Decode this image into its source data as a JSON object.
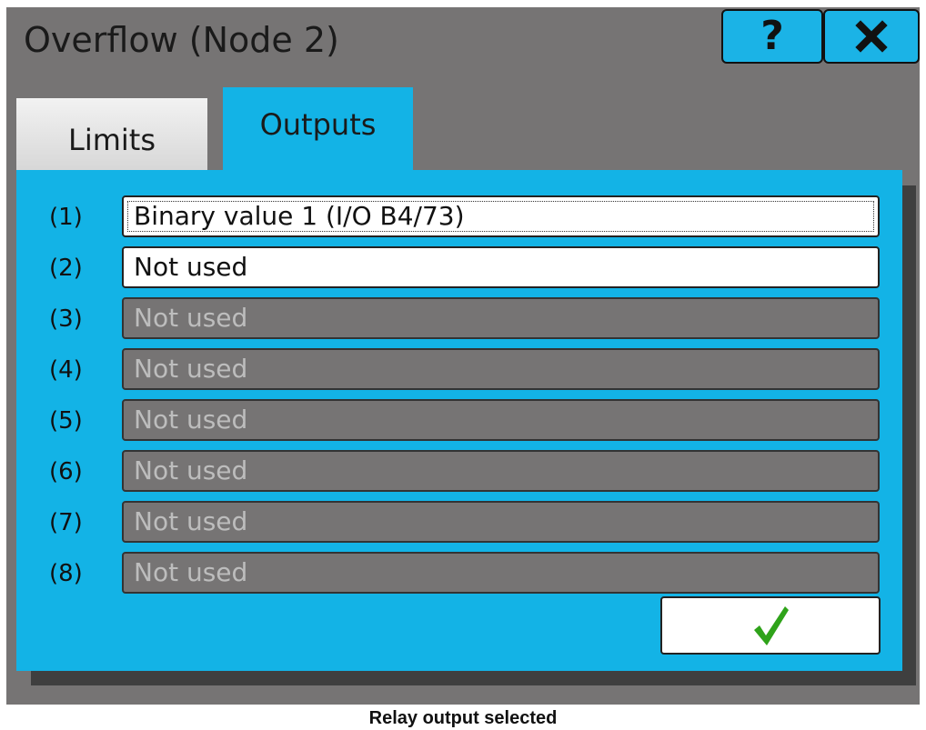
{
  "window": {
    "title": "Overflow (Node 2)",
    "help_label": "?",
    "accent_color": "#13b3e6",
    "background_color": "#767474"
  },
  "tabs": [
    {
      "label": "Limits",
      "active": false
    },
    {
      "label": "Outputs",
      "active": true
    }
  ],
  "outputs": [
    {
      "number": "(1)",
      "value": "Binary value 1 (I/O B4/73)",
      "state": "active",
      "focused": true
    },
    {
      "number": "(2)",
      "value": "Not used",
      "state": "active",
      "focused": false
    },
    {
      "number": "(3)",
      "value": "Not used",
      "state": "disabled",
      "focused": false
    },
    {
      "number": "(4)",
      "value": "Not used",
      "state": "disabled",
      "focused": false
    },
    {
      "number": "(5)",
      "value": "Not used",
      "state": "disabled",
      "focused": false
    },
    {
      "number": "(6)",
      "value": "Not used",
      "state": "disabled",
      "focused": false
    },
    {
      "number": "(7)",
      "value": "Not used",
      "state": "disabled",
      "focused": false
    },
    {
      "number": "(8)",
      "value": "Not used",
      "state": "disabled",
      "focused": false
    }
  ],
  "confirm_icon": "checkmark-icon",
  "caption": "Relay output selected"
}
